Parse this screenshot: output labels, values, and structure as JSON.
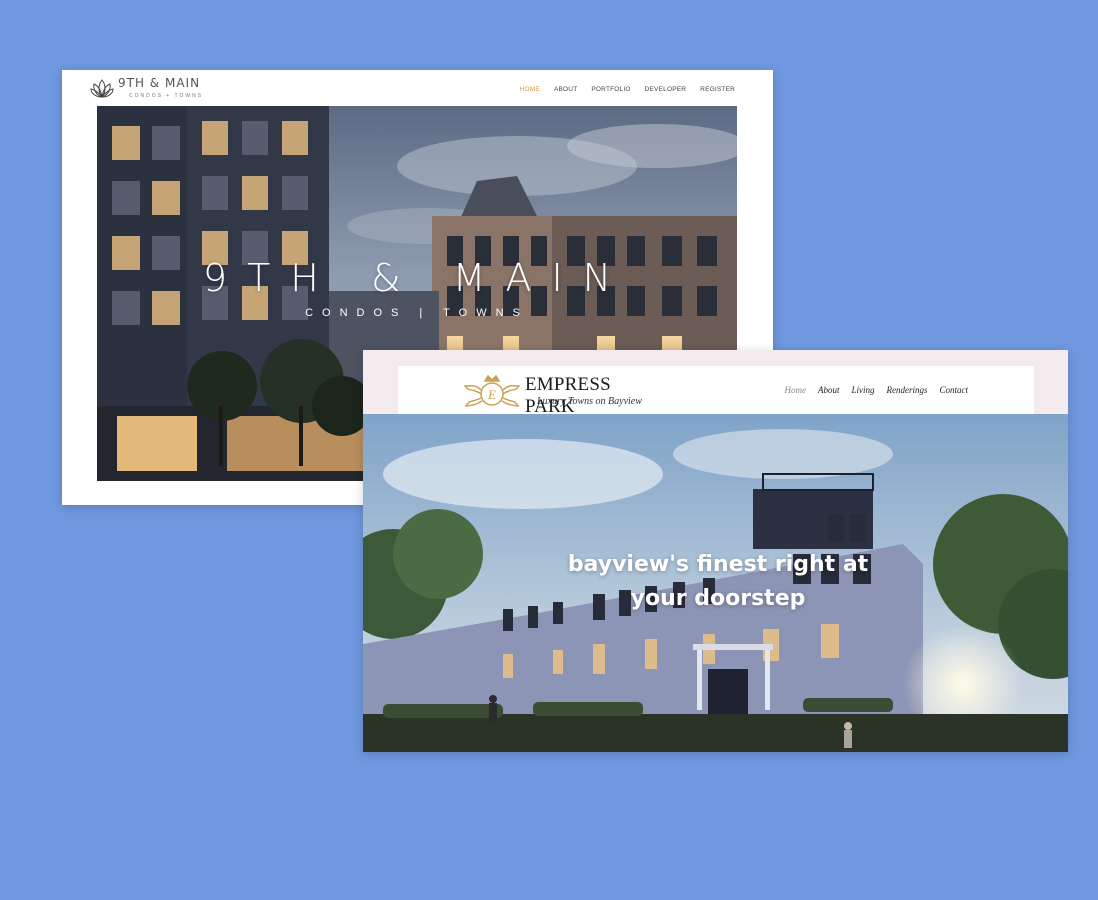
{
  "site_a": {
    "logo_name": "9TH & MAIN",
    "logo_sub": "CONDOS + TOWNS",
    "nav": [
      {
        "label": "HOME",
        "active": true
      },
      {
        "label": "ABOUT",
        "active": false
      },
      {
        "label": "PORTFOLIO",
        "active": false
      },
      {
        "label": "DEVELOPER",
        "active": false
      },
      {
        "label": "REGISTER",
        "active": false
      }
    ],
    "hero_title": "9TH & MAIN",
    "hero_subtitle": "CONDOS | TOWNS",
    "accent_color": "#d59a4a"
  },
  "site_b": {
    "logo_name": "EMPRESS PARK",
    "logo_tagline": "Luxury Towns on Bayview",
    "nav": [
      {
        "label": "Home",
        "active": true
      },
      {
        "label": "About",
        "active": false
      },
      {
        "label": "Living",
        "active": false
      },
      {
        "label": "Renderings",
        "active": false
      },
      {
        "label": "Contact",
        "active": false
      }
    ],
    "hero_headline_line1": "bayview's finest right at",
    "hero_headline_line2": "your doorstep",
    "logo_color": "#c9a24f"
  },
  "background_color": "#6f98e0"
}
